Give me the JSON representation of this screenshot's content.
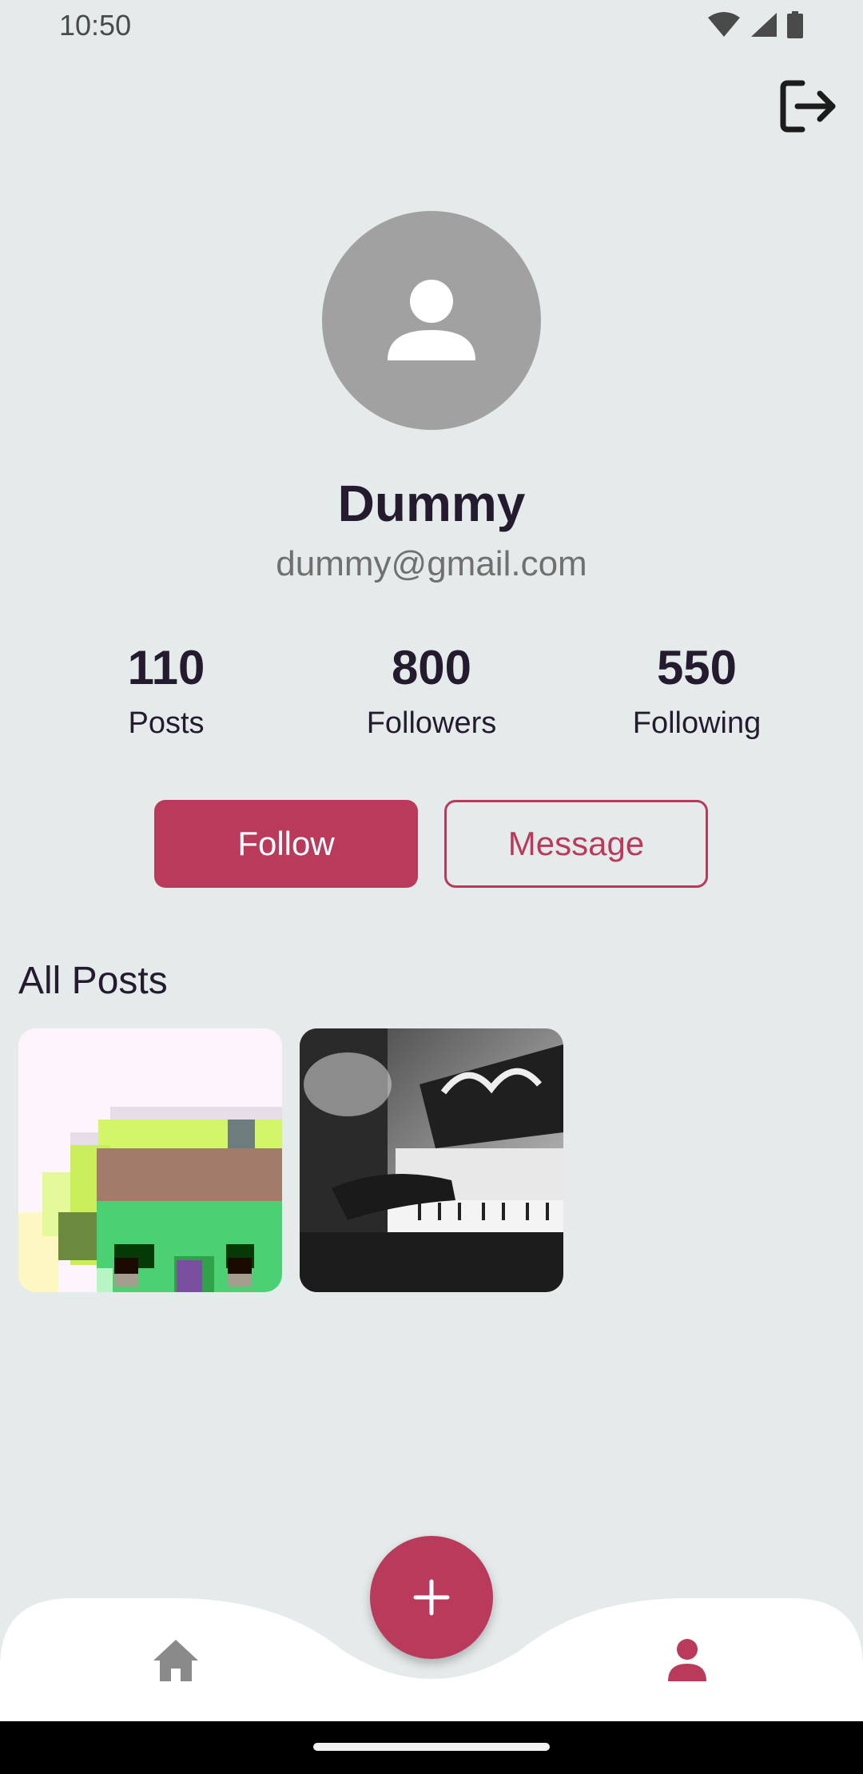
{
  "status_bar": {
    "time": "10:50",
    "icons": [
      "wifi-icon",
      "signal-icon",
      "battery-icon"
    ]
  },
  "header": {
    "logout_icon": "logout-icon"
  },
  "profile": {
    "name": "Dummy",
    "email": "dummy@gmail.com",
    "avatar_icon": "person-icon"
  },
  "stats": [
    {
      "value": "110",
      "label": "Posts"
    },
    {
      "value": "800",
      "label": "Followers"
    },
    {
      "value": "550",
      "label": "Following"
    }
  ],
  "actions": {
    "follow_label": "Follow",
    "message_label": "Message"
  },
  "posts": {
    "title": "All Posts",
    "items": [
      "pixel-art-post",
      "piano-photo-post"
    ]
  },
  "bottom_nav": {
    "items": [
      {
        "icon": "home-icon",
        "active": false
      },
      {
        "icon": "profile-icon",
        "active": true
      }
    ],
    "fab_icon": "plus-icon"
  },
  "colors": {
    "accent": "#b93a5b",
    "background": "#e5ebeb",
    "text": "#241c2e",
    "muted": "#707070",
    "avatar_bg": "#a1a1a1"
  }
}
